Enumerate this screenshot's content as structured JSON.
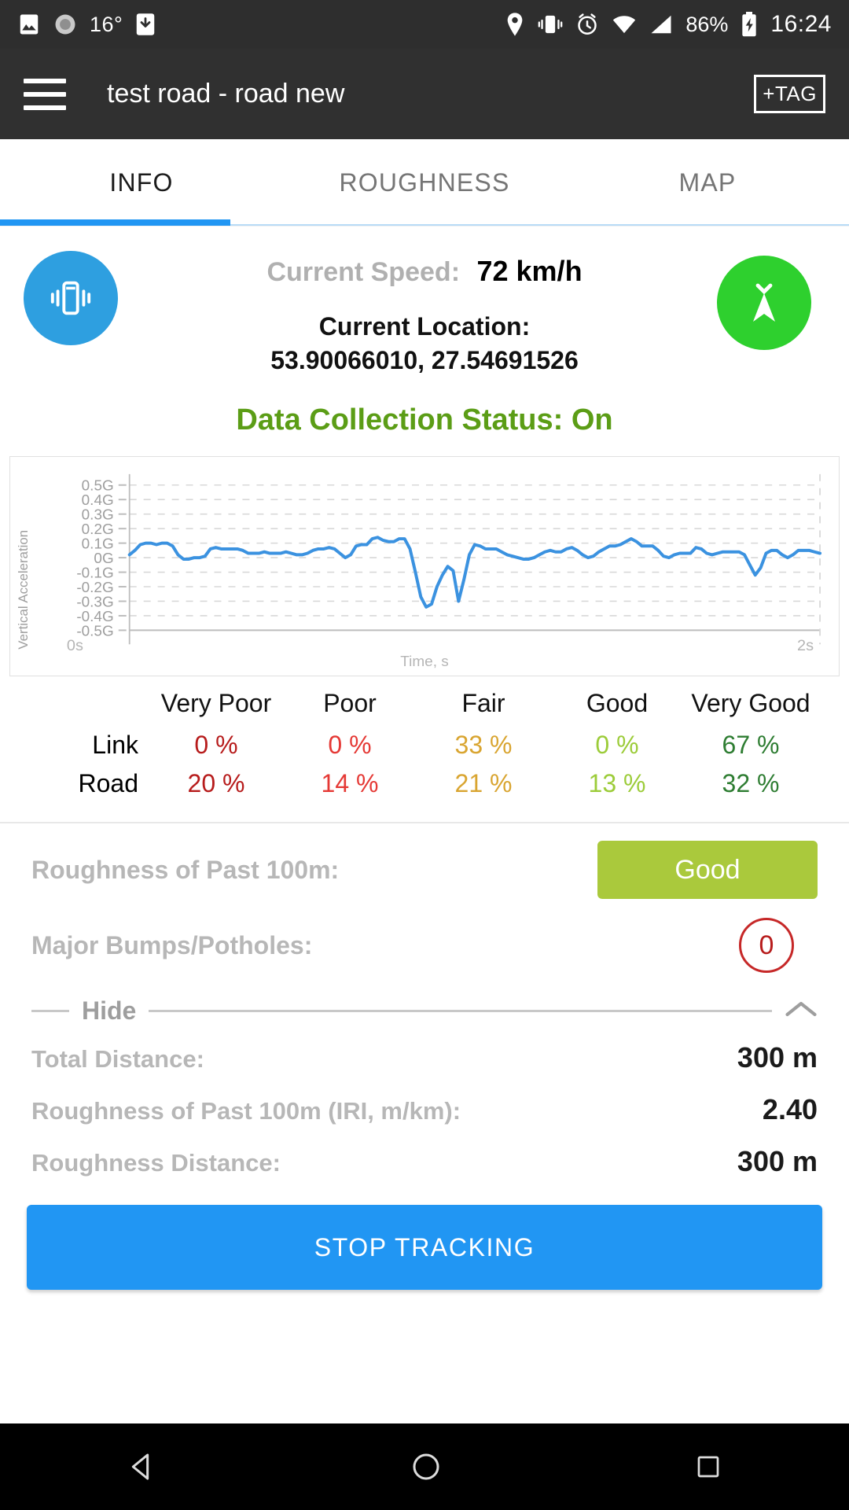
{
  "status_bar": {
    "temperature": "16°",
    "battery": "86%",
    "clock": "16:24",
    "icons_left": [
      "image-icon",
      "brightness-icon",
      "download-icon"
    ],
    "icons_right": [
      "location-icon",
      "vibrate-icon",
      "alarm-icon",
      "wifi-icon",
      "signal-icon",
      "battery-charging-icon"
    ]
  },
  "app_bar": {
    "menu_icon": "hamburger-menu-icon",
    "title": "test road - road new",
    "tag_button": "+TAG"
  },
  "tabs": [
    {
      "label": "INFO",
      "active": true
    },
    {
      "label": "ROUGHNESS",
      "active": false
    },
    {
      "label": "MAP",
      "active": false
    }
  ],
  "info": {
    "vibrate_button_icon": "vibrate-icon",
    "gps_button_icon": "gps-antenna-icon",
    "speed_label": "Current Speed:",
    "speed_value": "72 km/h",
    "location_label": "Current Location:",
    "location_value": "53.90066010, 27.54691526",
    "data_collection_status": "Data Collection Status: On",
    "status_color": "#5b9d16"
  },
  "chart_data": {
    "type": "line",
    "title": "",
    "xlabel": "Time, s",
    "ylabel": "Vertical Acceleration",
    "x_ticks": [
      "0s",
      "2s"
    ],
    "xlim": [
      0,
      2
    ],
    "ylim": [
      -0.5,
      0.5
    ],
    "y_ticks": [
      "0.5G",
      "0.4G",
      "0.3G",
      "0.2G",
      "0.1G",
      "0G",
      "-0.1G",
      "-0.2G",
      "-0.3G",
      "-0.4G",
      "-0.5G"
    ],
    "y_tick_values": [
      0.5,
      0.4,
      0.3,
      0.2,
      0.1,
      0,
      -0.1,
      -0.2,
      -0.3,
      -0.4,
      -0.5
    ],
    "grid": true,
    "legend": "none",
    "line_color": "#3b92e0",
    "series": [
      {
        "name": "Vertical Acceleration",
        "values": [
          0.02,
          0.05,
          0.09,
          0.1,
          0.1,
          0.09,
          0.1,
          0.1,
          0.08,
          0.02,
          -0.01,
          -0.01,
          0.0,
          0.0,
          0.01,
          0.06,
          0.07,
          0.06,
          0.06,
          0.06,
          0.06,
          0.05,
          0.03,
          0.03,
          0.03,
          0.04,
          0.03,
          0.03,
          0.03,
          0.04,
          0.03,
          0.02,
          0.02,
          0.03,
          0.05,
          0.06,
          0.06,
          0.07,
          0.06,
          0.03,
          0.0,
          0.02,
          0.08,
          0.09,
          0.09,
          0.13,
          0.14,
          0.12,
          0.11,
          0.11,
          0.13,
          0.13,
          0.06,
          -0.1,
          -0.27,
          -0.34,
          -0.32,
          -0.2,
          -0.12,
          -0.06,
          -0.09,
          -0.3,
          -0.15,
          0.02,
          0.09,
          0.08,
          0.06,
          0.06,
          0.06,
          0.04,
          0.02,
          0.01,
          0.0,
          -0.01,
          -0.01,
          0.0,
          0.02,
          0.04,
          0.05,
          0.04,
          0.04,
          0.06,
          0.07,
          0.05,
          0.02,
          0.0,
          0.01,
          0.04,
          0.06,
          0.08,
          0.08,
          0.09,
          0.11,
          0.13,
          0.11,
          0.08,
          0.08,
          0.08,
          0.05,
          0.01,
          0.0,
          0.02,
          0.03,
          0.03,
          0.03,
          0.07,
          0.06,
          0.03,
          0.02,
          0.03,
          0.04,
          0.04,
          0.04,
          0.04,
          0.02,
          -0.05,
          -0.12,
          -0.07,
          0.03,
          0.05,
          0.05,
          0.02,
          0.0,
          0.02,
          0.05,
          0.05,
          0.05,
          0.04,
          0.03
        ]
      }
    ]
  },
  "quality_table": {
    "columns": [
      "Very Poor",
      "Poor",
      "Fair",
      "Good",
      "Very Good"
    ],
    "column_colors": [
      "#b71c1c",
      "#e53935",
      "#d9a531",
      "#9ccc39",
      "#2e7d32"
    ],
    "rows": [
      {
        "label": "Link",
        "values": [
          "0 %",
          "0 %",
          "33 %",
          "0 %",
          "67 %"
        ]
      },
      {
        "label": "Road",
        "values": [
          "20 %",
          "14 %",
          "21 %",
          "13 %",
          "32 %"
        ]
      }
    ]
  },
  "details": {
    "roughness_label": "Roughness of Past 100m:",
    "roughness_value": "Good",
    "roughness_color": "#aac93c",
    "bumps_label": "Major Bumps/Potholes:",
    "bumps_value": "0",
    "bumps_color": "#b71c1c",
    "hide_label": "Hide",
    "hide_icon": "chevron-up-icon",
    "stats": [
      {
        "key": "Total Distance:",
        "value": "300 m"
      },
      {
        "key": "Roughness of Past 100m (IRI, m/km):",
        "value": "2.40"
      },
      {
        "key": "Roughness Distance:",
        "value": "300 m"
      }
    ]
  },
  "cta": {
    "label": "STOP TRACKING",
    "color": "#2196f3"
  },
  "nav_bar": {
    "back_icon": "back-triangle-icon",
    "home_icon": "home-circle-icon",
    "recents_icon": "recents-square-icon"
  }
}
